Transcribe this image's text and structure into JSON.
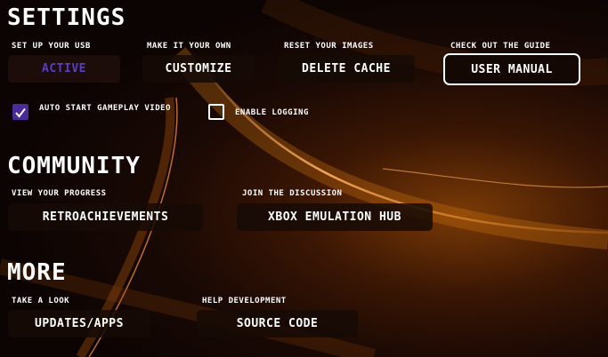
{
  "colors": {
    "background": "#0b0403",
    "glow": "#7a3a06",
    "accent_purple": "#5a3cc8",
    "checkbox_fill": "#4a2b9c",
    "text": "#ffffff"
  },
  "settings": {
    "title": "SETTINGS",
    "items": [
      {
        "caption": "SET UP YOUR USB",
        "button": "ACTIVE"
      },
      {
        "caption": "MAKE IT YOUR OWN",
        "button": "CUSTOMIZE"
      },
      {
        "caption": "RESET YOUR IMAGES",
        "button": "DELETE CACHE"
      },
      {
        "caption": "CHECK OUT THE GUIDE",
        "button": "USER MANUAL"
      }
    ],
    "checkboxes": [
      {
        "label": "AUTO START GAMEPLAY VIDEO",
        "checked": true
      },
      {
        "label": "ENABLE LOGGING",
        "checked": false
      }
    ]
  },
  "community": {
    "title": "COMMUNITY",
    "items": [
      {
        "caption": "VIEW YOUR PROGRESS",
        "button": "RETROACHIEVEMENTS"
      },
      {
        "caption": "JOIN THE DISCUSSION",
        "button": "XBOX EMULATION HUB"
      }
    ]
  },
  "more": {
    "title": "MORE",
    "items": [
      {
        "caption": "TAKE A LOOK",
        "button": "UPDATES/APPS"
      },
      {
        "caption": "HELP DEVELOPMENT",
        "button": "SOURCE CODE"
      }
    ]
  }
}
